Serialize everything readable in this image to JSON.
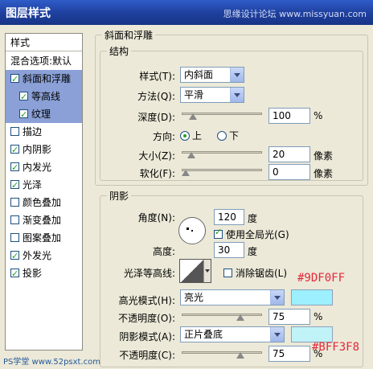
{
  "window": {
    "title": "图层样式",
    "watermark": "思缘设计论坛 www.missyuan.com"
  },
  "sidebar": {
    "header": "样式",
    "items": [
      {
        "label": "混合选项:默认",
        "checkbox": false,
        "checked": false,
        "selected": false,
        "sub": false
      },
      {
        "label": "斜面和浮雕",
        "checkbox": true,
        "checked": true,
        "selected": true,
        "sub": false
      },
      {
        "label": "等高线",
        "checkbox": true,
        "checked": true,
        "selected": true,
        "sub": true
      },
      {
        "label": "纹理",
        "checkbox": true,
        "checked": true,
        "selected": true,
        "sub": true
      },
      {
        "label": "描边",
        "checkbox": true,
        "checked": false,
        "selected": false,
        "sub": false
      },
      {
        "label": "内阴影",
        "checkbox": true,
        "checked": true,
        "selected": false,
        "sub": false
      },
      {
        "label": "内发光",
        "checkbox": true,
        "checked": true,
        "selected": false,
        "sub": false
      },
      {
        "label": "光泽",
        "checkbox": true,
        "checked": true,
        "selected": false,
        "sub": false
      },
      {
        "label": "颜色叠加",
        "checkbox": true,
        "checked": false,
        "selected": false,
        "sub": false
      },
      {
        "label": "渐变叠加",
        "checkbox": true,
        "checked": false,
        "selected": false,
        "sub": false
      },
      {
        "label": "图案叠加",
        "checkbox": true,
        "checked": false,
        "selected": false,
        "sub": false
      },
      {
        "label": "外发光",
        "checkbox": true,
        "checked": true,
        "selected": false,
        "sub": false
      },
      {
        "label": "投影",
        "checkbox": true,
        "checked": true,
        "selected": false,
        "sub": false
      }
    ]
  },
  "bevel": {
    "title": "斜面和浮雕",
    "structure_title": "结构",
    "style_label": "样式(T):",
    "style_value": "内斜面",
    "method_label": "方法(Q):",
    "method_value": "平滑",
    "depth_label": "深度(D):",
    "depth_value": "100",
    "depth_unit": "%",
    "depth_pos": 0.1,
    "direction_label": "方向:",
    "dir_up": "上",
    "dir_down": "下",
    "size_label": "大小(Z):",
    "size_value": "20",
    "size_unit": "像素",
    "size_pos": 0.08,
    "soften_label": "软化(F):",
    "soften_value": "0",
    "soften_unit": "像素",
    "soften_pos": 0.0
  },
  "shading": {
    "title": "阴影",
    "angle_label": "角度(N):",
    "angle_value": "120",
    "angle_unit": "度",
    "global_light_label": "使用全局光(G)",
    "global_light_checked": true,
    "altitude_label": "高度:",
    "altitude_value": "30",
    "altitude_unit": "度",
    "gloss_label": "光泽等高线:",
    "antialias_label": "消除锯齿(L)",
    "antialias_checked": false,
    "highlight_mode_label": "高光模式(H):",
    "highlight_mode_value": "亮光",
    "highlight_color": "#9DF0FF",
    "highlight_opacity_label": "不透明度(O):",
    "highlight_opacity_value": "75",
    "highlight_opacity_unit": "%",
    "highlight_opacity_pos": 0.75,
    "shadow_mode_label": "阴影模式(A):",
    "shadow_mode_value": "正片叠底",
    "shadow_color": "#BFF3F8",
    "shadow_opacity_label": "不透明度(C):",
    "shadow_opacity_value": "75",
    "shadow_opacity_unit": "%",
    "shadow_opacity_pos": 0.75
  },
  "annotations": {
    "highlight_hex": "#9DF0FF",
    "shadow_hex": "#BFF3F8"
  },
  "watermarks": {
    "bottom_left": "PS学堂 www.52psxt.com"
  }
}
